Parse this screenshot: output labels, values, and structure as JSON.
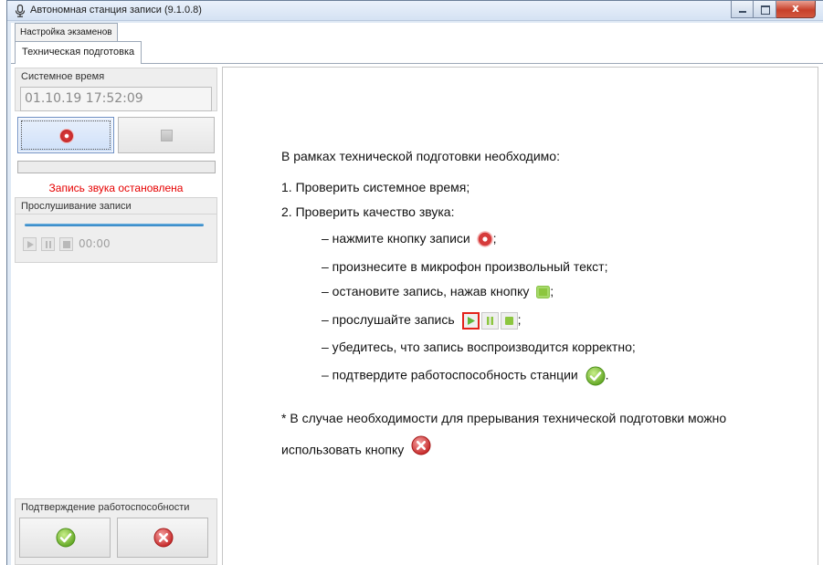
{
  "window": {
    "title": "Автономная станция записи (9.1.0.8)",
    "close_glyph": "x"
  },
  "tabs": {
    "top": "Настройка экзаменов",
    "sub": "Техническая подготовка"
  },
  "left": {
    "system_time_title": "Системное время",
    "system_time_value": "01.10.19 17:52:09",
    "recording_status": "Запись звука остановлена",
    "recording_status_color": "#e60000",
    "level_fraction": 0,
    "listen_title": "Прослушивание записи",
    "playback_time": "00:00",
    "confirm_title": "Подтверждение работоспособности"
  },
  "instructions": {
    "intro": "В рамках технической подготовки необходимо:",
    "step1": "1. Проверить системное время;",
    "step2": "2. Проверить качество звука:",
    "sub1_prefix": "–  нажмите кнопку записи",
    "sub1_suffix": ";",
    "sub2": "–  произнесите в микрофон произвольный текст;",
    "sub3_prefix": "–  остановите запись, нажав кнопку",
    "sub3_suffix": ";",
    "sub4_prefix": "–  прослушайте запись",
    "sub4_suffix": ";",
    "sub5": "–  убедитесь, что запись воспроизводится корректно;",
    "sub6_prefix": "–  подтвердите работоспособность станции",
    "sub6_suffix": ".",
    "note_line1": "* В случае необходимости для прерывания технической подготовки можно",
    "note_line2": "использовать кнопку"
  },
  "icons": {
    "app": "microphone-icon",
    "record": "record-icon",
    "stop": "stop-icon",
    "play": "play-icon",
    "pause": "pause-icon",
    "ok": "check-circle-icon",
    "cancel": "cancel-circle-icon"
  }
}
